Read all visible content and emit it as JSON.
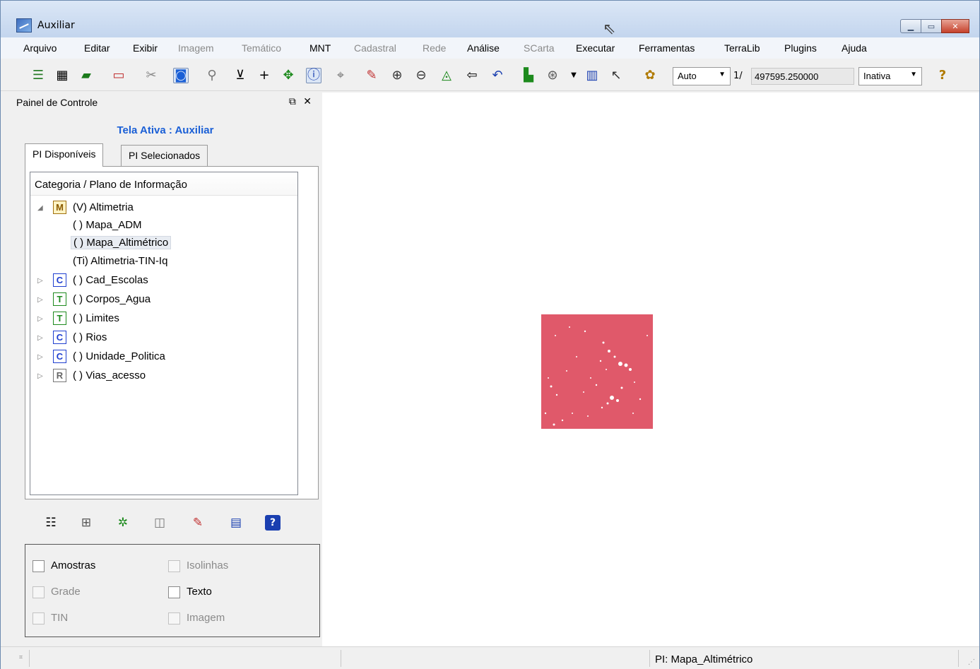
{
  "window": {
    "title": "Auxiliar"
  },
  "menu": [
    {
      "label": "Arquivo",
      "enabled": true
    },
    {
      "label": "Editar",
      "enabled": true
    },
    {
      "label": "Exibir",
      "enabled": true
    },
    {
      "label": "Imagem",
      "enabled": false
    },
    {
      "label": "Temático",
      "enabled": false
    },
    {
      "label": "MNT",
      "enabled": true
    },
    {
      "label": "Cadastral",
      "enabled": false
    },
    {
      "label": "Rede",
      "enabled": false
    },
    {
      "label": "Análise",
      "enabled": true
    },
    {
      "label": "SCarta",
      "enabled": false
    },
    {
      "label": "Executar",
      "enabled": true
    },
    {
      "label": "Ferramentas",
      "enabled": true
    },
    {
      "label": "TerraLib",
      "enabled": true
    },
    {
      "label": "Plugins",
      "enabled": true
    },
    {
      "label": "Ajuda",
      "enabled": true
    }
  ],
  "toolbar": {
    "zoom_mode": "Auto",
    "scale_prefix": "1/",
    "scale_value": "497595.250000",
    "status_select": "Inativa",
    "icons": [
      "layers-icon",
      "grid-icon",
      "eraser-shape-icon",
      "rectangle-icon",
      "clear-icon",
      "select-icon",
      "zoom-icon",
      "insert-icon",
      "add-point-icon",
      "pan-icon",
      "info-icon",
      "measure-icon",
      "edit-icon",
      "zoom-in-icon",
      "zoom-out-icon",
      "zoom-area-icon",
      "back-icon",
      "undo-icon",
      "raster-icon",
      "symbol-icon",
      "legend-icon",
      "cursor-plus-icon",
      "palette-icon",
      "help-icon"
    ]
  },
  "panel": {
    "title": "Painel de Controle",
    "active_screen": "Tela Ativa : Auxiliar",
    "tabs": [
      "PI Disponíveis",
      "PI Selecionados"
    ],
    "tree_header": "Categoria / Plano de Informação",
    "tree": [
      {
        "label": "(V) Altimetria",
        "icon": "M",
        "expanded": true,
        "children": [
          "( ) Mapa_ADM",
          "( ) Mapa_Altimétrico",
          "(Ti) Altimetria-TIN-Iq"
        ]
      },
      {
        "label": "( ) Cad_Escolas",
        "icon": "C"
      },
      {
        "label": "( ) Corpos_Agua",
        "icon": "T"
      },
      {
        "label": "( ) Limites",
        "icon": "T"
      },
      {
        "label": "( ) Rios",
        "icon": "C"
      },
      {
        "label": "( ) Unidade_Politica",
        "icon": "C"
      },
      {
        "label": "( ) Vias_acesso",
        "icon": "R"
      }
    ],
    "selected_child": "( ) Mapa_Altimétrico",
    "checks": [
      {
        "label": "Amostras",
        "enabled": true
      },
      {
        "label": "Isolinhas",
        "enabled": false
      },
      {
        "label": "Grade",
        "enabled": false
      },
      {
        "label": "Texto",
        "enabled": true
      },
      {
        "label": "TIN",
        "enabled": false
      },
      {
        "label": "Imagem",
        "enabled": false
      }
    ]
  },
  "canvas": {
    "raster_color": "#e0596a"
  },
  "status": {
    "text": "PI: Mapa_Altimétrico"
  }
}
